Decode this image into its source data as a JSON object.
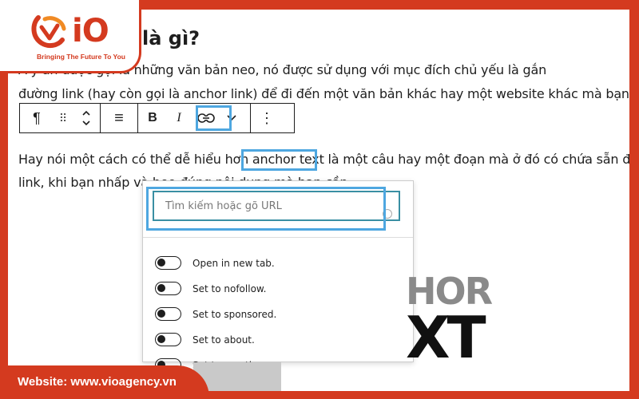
{
  "heading": "là gì?",
  "paragraph1_line1": "A         y     ăn được gọi là những văn bản neo, nó được sử dụng với mục đích chủ yếu là gắn",
  "paragraph1_line2": "đường link (hay còn gọi là anchor link) để đi đến một văn bản khác hay một website khác mà bạn muốn",
  "paragraph2_line1": "Hay nói một cách có thể dễ hiểu hơn anchor text là một câu hay một đoạn mà ở đó có chứa sẵn đường",
  "paragraph2_line2": "link, khi bạn nhấp và                                                   heo đúng nội dung mà bạn cần.",
  "toolbar": {
    "paragraph_icon": "¶",
    "drag_icon": "⠿",
    "align_icon": "≡",
    "bold_label": "B",
    "italic_label": "I",
    "chevron": "⌄",
    "more_icon": "⋮"
  },
  "link_popover": {
    "placeholder": "Tìm kiếm hoặc gõ URL",
    "options": [
      {
        "label": "Open in new tab."
      },
      {
        "label": "Set to nofollow."
      },
      {
        "label": "Set to sponsored."
      },
      {
        "label": "Set to about."
      },
      {
        "label": "Set to mentions."
      }
    ]
  },
  "graphic_text_top": "HOR",
  "graphic_text_bottom": "XT",
  "logo": {
    "text": "iO",
    "tagline": "Bringing The Future To You"
  },
  "footer": {
    "text": "Website: www.vioagency.vn"
  },
  "colors": {
    "brand": "#d43a1f",
    "highlight": "#4ea7e0",
    "input_border": "#3a8fa3"
  }
}
